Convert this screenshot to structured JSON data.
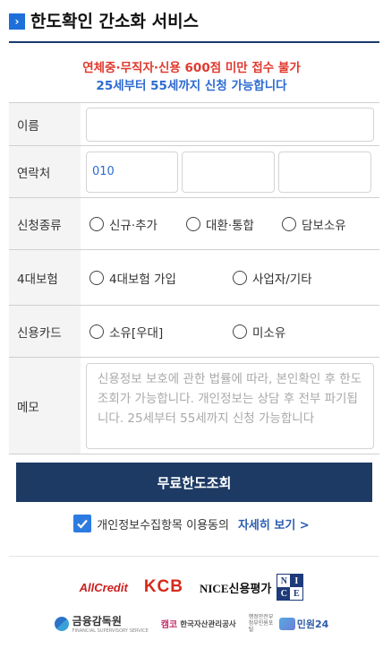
{
  "header": {
    "arrow_glyph": "›",
    "title": "한도확인 간소화 서비스"
  },
  "notice": {
    "line1": "연체중·무직자·신용 600점 미만 접수 불가",
    "line2": "25세부터 55세까지 신청 가능합니다"
  },
  "form": {
    "name": {
      "label": "이름",
      "value": ""
    },
    "phone": {
      "label": "연락처",
      "prefix": "010",
      "middle": "",
      "last": ""
    },
    "apply_type": {
      "label": "신청종류",
      "options": [
        "신규·추가",
        "대환·통합",
        "담보소유"
      ]
    },
    "insurance": {
      "label": "4대보험",
      "options": [
        "4대보험 가입",
        "사업자/기타"
      ]
    },
    "credit_card": {
      "label": "신용카드",
      "options": [
        "소유[우대]",
        "미소유"
      ]
    },
    "memo": {
      "label": "메모",
      "placeholder": "신용정보 보호에 관한 법률에 따라, 본인확인 후 한도조회가 가능합니다. 개인정보는 상담 후 전부 파기됩니다. 25세부터 55세까지 신청 가능합니다"
    }
  },
  "submit_label": "무료한도조회",
  "consent": {
    "checked": true,
    "text": "개인정보수집항목 이용동의",
    "link": "자세히 보기 >"
  },
  "partners": {
    "allcredit": "AllCredit",
    "kcb": "KCB",
    "nice": "NICE신용평가",
    "nice_logo": [
      "N",
      "I",
      "C",
      "E"
    ],
    "fss_name": "금융감독원",
    "fss_sub": "FINANCIAL SUPERVISORY SERVICE",
    "kamco_mark": "캠코",
    "kamco_name": "한국자산관리공사",
    "minwon_small": "행정안전부 정부민원포털",
    "minwon_name": "민원24"
  },
  "colors": {
    "brand_navy": "#1d3a64",
    "accent_blue": "#2d6bd0",
    "warning_red": "#e03a2f"
  }
}
